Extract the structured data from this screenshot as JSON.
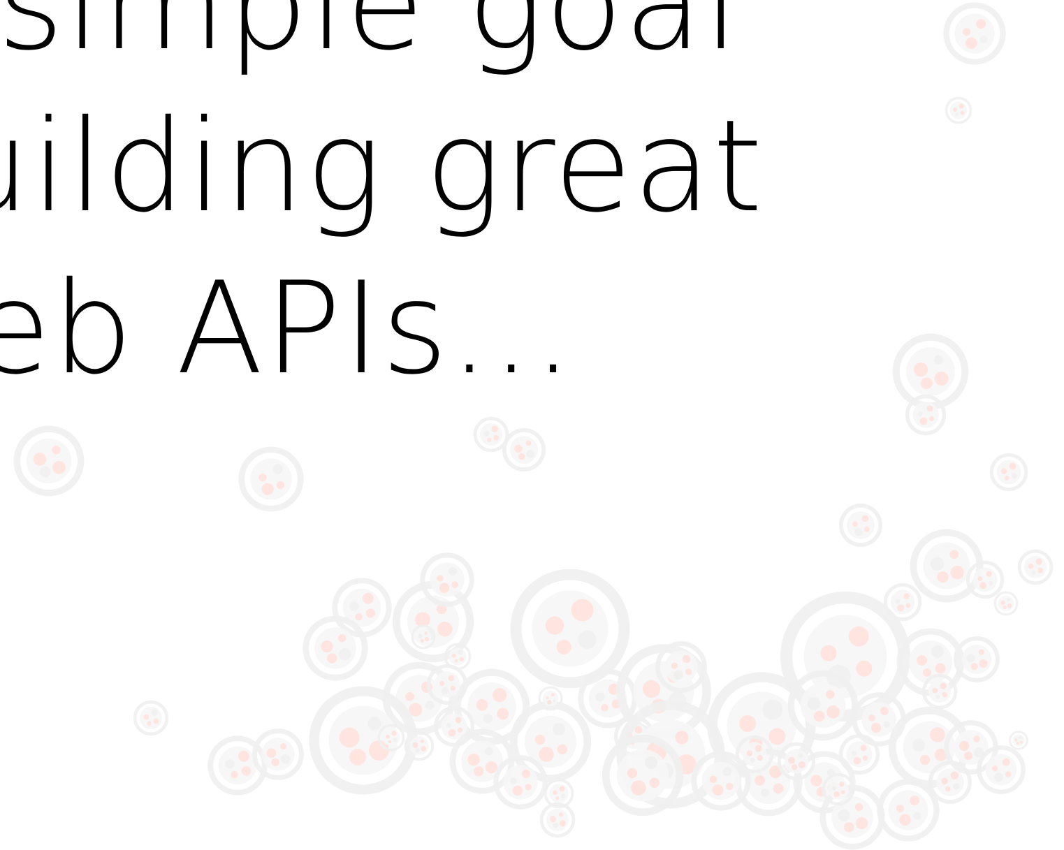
{
  "hero": {
    "lines": [
      "A simple goal",
      "building great",
      "web APIs..."
    ]
  },
  "colors": {
    "background": "#ffffff",
    "text": "#000000",
    "bubble_ring": "#f0f0f0",
    "bubble_dot": "#ffe2dc"
  },
  "decoration": {
    "icon": "bubble-cluster-icon"
  }
}
